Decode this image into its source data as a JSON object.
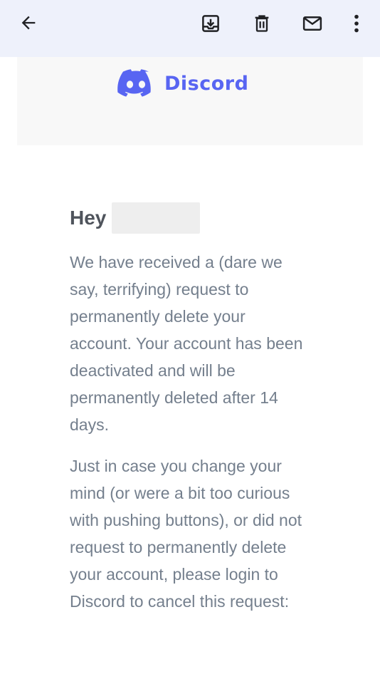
{
  "toolbar": {
    "back_icon": "arrow-back-icon",
    "archive_icon": "archive-icon",
    "delete_icon": "trash-icon",
    "mark_unread_icon": "mail-icon",
    "more_icon": "more-vert-icon"
  },
  "email": {
    "brand_name": "Discord",
    "brand_color": "#5865f2",
    "greeting": "Hey",
    "paragraph1": "We have received a (dare we say, terrifying) request to permanently delete your account. Your account has been deactivated and will be permanently deleted after 14 days.",
    "paragraph2": "Just in case you change your mind (or were a bit too curious with pushing buttons), or did not request to permanently delete your account, please login to Discord to cancel this request:"
  }
}
